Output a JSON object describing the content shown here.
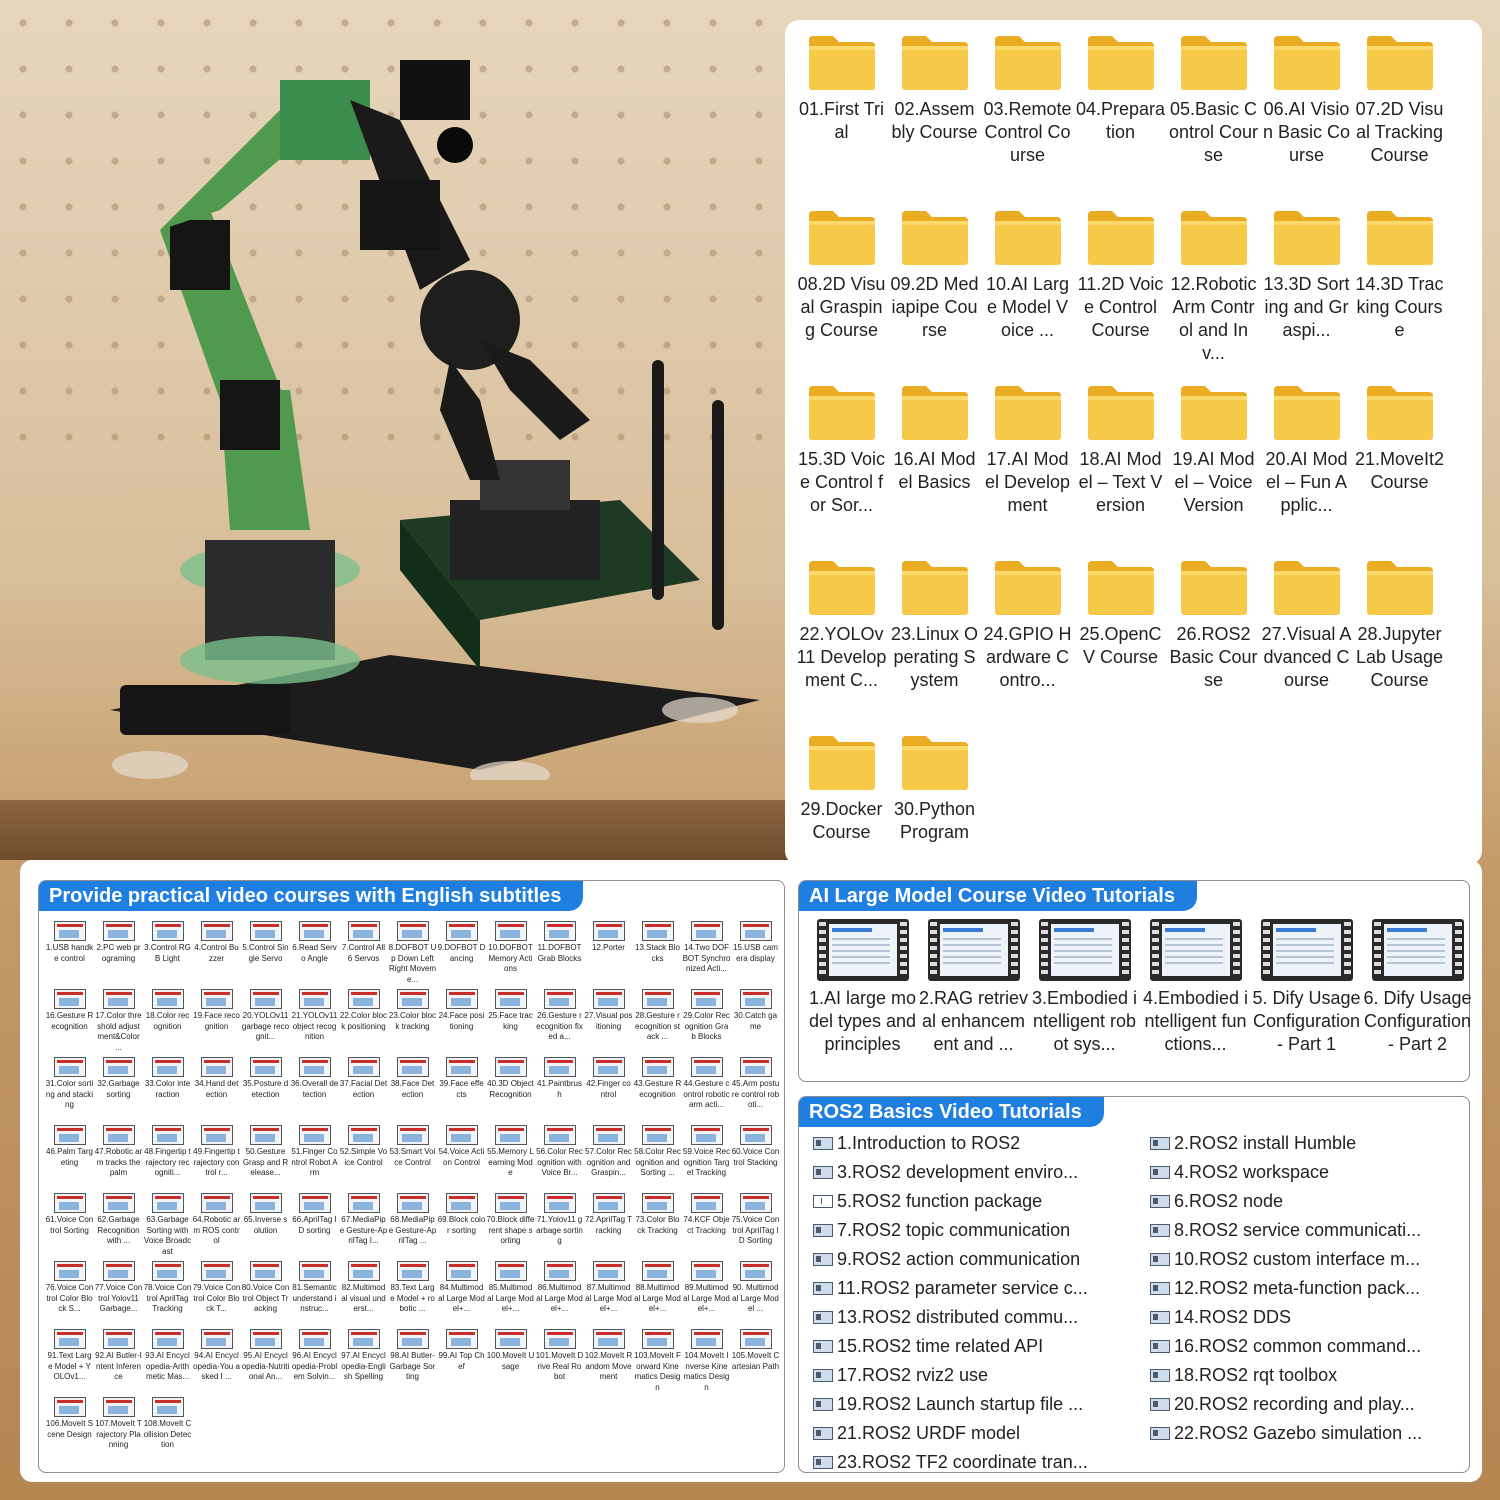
{
  "folders": [
    {
      "label": "01.First Trial"
    },
    {
      "label": "02.Assembly Course"
    },
    {
      "label": "03.Remote Control Course"
    },
    {
      "label": "04.Preparation"
    },
    {
      "label": "05.Basic Control Course"
    },
    {
      "label": "06.AI Vision Basic Course"
    },
    {
      "label": "07.2D Visual Tracking Course"
    },
    {
      "label": "08.2D Visual Grasping Course"
    },
    {
      "label": "09.2D Mediapipe Course"
    },
    {
      "label": "10.AI Large Model Voice ..."
    },
    {
      "label": "11.2D Voice Control Course"
    },
    {
      "label": "12.Robotic Arm Control and Inv..."
    },
    {
      "label": "13.3D Sorting and Graspi..."
    },
    {
      "label": "14.3D Tracking Course"
    },
    {
      "label": "15.3D Voice Control for Sor..."
    },
    {
      "label": "16.AI Model Basics"
    },
    {
      "label": "17.AI Model Development"
    },
    {
      "label": "18.AI Model – Text Version"
    },
    {
      "label": "19.AI Model – Voice Version"
    },
    {
      "label": "20.AI Model – Fun Applic..."
    },
    {
      "label": "21.MoveIt2 Course"
    },
    {
      "label": "22.YOLOv11 Development C..."
    },
    {
      "label": "23.Linux Operating System"
    },
    {
      "label": "24.GPIO Hardware Contro..."
    },
    {
      "label": "25.OpenCV Course"
    },
    {
      "label": "26.ROS2 Basic Course"
    },
    {
      "label": "27.Visual Advanced Course"
    },
    {
      "label": "28.Jupyter Lab Usage Course"
    },
    {
      "label": "29.Docker Course"
    },
    {
      "label": "30.Python Program"
    }
  ],
  "practical": {
    "title": "Provide practical video courses with English subtitles",
    "videos": [
      "1.USB handke control",
      "2.PC web programing",
      "3.Control RGB Light",
      "4.Control Buzzer",
      "5.Control Single Servo",
      "6.Read Servo Angle",
      "7.Control All 6 Servos",
      "8.DOFBOT Up Down Left Right Moveme...",
      "9.DOFBOT Dancing",
      "10.DOFBOT Memory Actions",
      "11.DOFBOT Grab Blocks",
      "12.Porter",
      "13.Stack Blocks",
      "14.Two DOFBOT Synchronized Acti...",
      "15.USB camera display",
      "16.Gesture Recognition",
      "17.Color threshold adjustment&Color ...",
      "18.Color recognition",
      "19.Face recognition",
      "20.YOLOv11 garbage recognit...",
      "21.YOLOv11 object recognition",
      "22.Color block positioning",
      "23.Color block tracking",
      "24.Face positioning",
      "25.Face tracking",
      "26.Gesture recognition fixed a...",
      "27.Visual positioning",
      "28.Gesture recognition stack ...",
      "29.Color Recognition Grab Blocks",
      "30.Catch game",
      "31.Color sorting and stacking",
      "32.Garbage sorting",
      "33.Color interaction",
      "34.Hand detection",
      "35.Posture detection",
      "36.Overall detection",
      "37.Facial Detection",
      "38.Face Detection",
      "39.Face effects",
      "40.3D Object Recognition",
      "41.Paintbrush",
      "42.Finger control",
      "43.Gesture Recognition",
      "44.Gesture control robotic arm acti...",
      "45.Arm posture control roboti...",
      "46.Palm Targeting",
      "47.Robotic arm tracks the palm",
      "48.Fingertip trajectory recogniti...",
      "49.Fingertip trajectory control r...",
      "50.Gesture Grasp and Release...",
      "51.Finger Control Robot Arm",
      "52.Simple Voice Control",
      "53.Smart Voice Control",
      "54.Voice Action Control",
      "55.Memory Learning Mode",
      "56.Color Recognition with Voice Br...",
      "57.Color Recognition and Graspin...",
      "58.Color Recognition and Sorting ...",
      "59.Voice Recognition Target Tracking",
      "60.Voice Control Stacking",
      "61.Voice Control Sorting",
      "62.Garbage Recognition with ...",
      "63.Garbage Sorting with Voice Broadcast",
      "64.Robotic arm ROS control",
      "65.Inverse solution",
      "66.AprilTag ID sorting",
      "67.MediaPipe Gesture-AprilTag I...",
      "68.MediaPipe Gesture-AprilTag ...",
      "69.Block color sorting",
      "70.Block different shape sorting",
      "71.Yolov11 garbage sorting",
      "72.AprilTag Tracking",
      "73.Color Block Tracking",
      "74.KCF Object Tracking",
      "75.Voice Control AprilTag ID Sorting",
      "76.Voice Control Color Block S...",
      "77.Voice Control Yolov11 Garbage...",
      "78.Voice Control AprilTag Tracking",
      "79.Voice Control Color Block T...",
      "80.Voice Control Object Tracking",
      "81.Semantic understand instruc...",
      "82.Multimodal visual underst...",
      "83.Text Large Model + robotic ...",
      "84.Multimodal Large Model+...",
      "85.Multimodal Large Model+...",
      "86.Multimodal Large Model+...",
      "87.Multimodal Large Model+...",
      "88.Multimodal Large Model+...",
      "89.Multimodal Large Model+...",
      "90. Multimodal Large Model ...",
      "91.Text Large Model + YOLOv1...",
      "92.AI Butler-Intent Inference",
      "93.AI Encyclopedia-Arithmetic Mas...",
      "94.AI Encyclopedia-You asked I ...",
      "95.AI Encyclopedia-Nutritional An...",
      "96.AI Encyclopedia-Problem Solvin...",
      "97.AI Encyclopedia-English Spelling",
      "98.AI Butler-Garbage Sorting",
      "99.AI Top Chef",
      "100.MoveIt Usage",
      "101.MoveIt Drive Real Robot",
      "102.MoveIt Random Movement",
      "103.MoveIt Forward Kinematics Design",
      "104.MoveIt Inverse Kinematics Design",
      "105.MoveIt Cartesian Path",
      "106.MoveIt Scene Design",
      "107.MoveIt Trajectory Planning",
      "108.MoveIt Collision Detection"
    ]
  },
  "ai_course": {
    "title": "AI Large Model Course Video Tutorials",
    "items": [
      "1.AI large model types and principles",
      "2.RAG retrieval enhancement and ...",
      "3.Embodied intelligent robot sys...",
      "4.Embodied intelligent functions...",
      "5. Dify Usage Configuration - Part 1",
      "6. Dify Usage Configuration - Part 2"
    ]
  },
  "ros2": {
    "title": "ROS2 Basics Video Tutorials",
    "items": [
      "1.Introduction to ROS2",
      "2.ROS2 install Humble",
      "3.ROS2 development enviro...",
      "4.ROS2 workspace",
      "5.ROS2 function package",
      "6.ROS2 node",
      "7.ROS2 topic communication",
      "8.ROS2 service communicati...",
      "9.ROS2 action communication",
      "10.ROS2 custom interface m...",
      "11.ROS2 parameter service c...",
      "12.ROS2 meta-function pack...",
      "13.ROS2 distributed commu...",
      "14.ROS2 DDS",
      "15.ROS2 time related API",
      "16.ROS2 common command...",
      "17.ROS2 rviz2 use",
      "18.ROS2 rqt toolbox",
      "19.ROS2 Launch startup file ...",
      "20.ROS2 recording and play...",
      "21.ROS2 URDF model",
      "22.ROS2 Gazebo simulation ...",
      "23.ROS2 TF2 coordinate tran..."
    ]
  },
  "colors": {
    "accent": "#1f7fe0",
    "folder": "#f7c948",
    "robot_green": "#4f9a4f",
    "board": "#1f1f1f"
  }
}
